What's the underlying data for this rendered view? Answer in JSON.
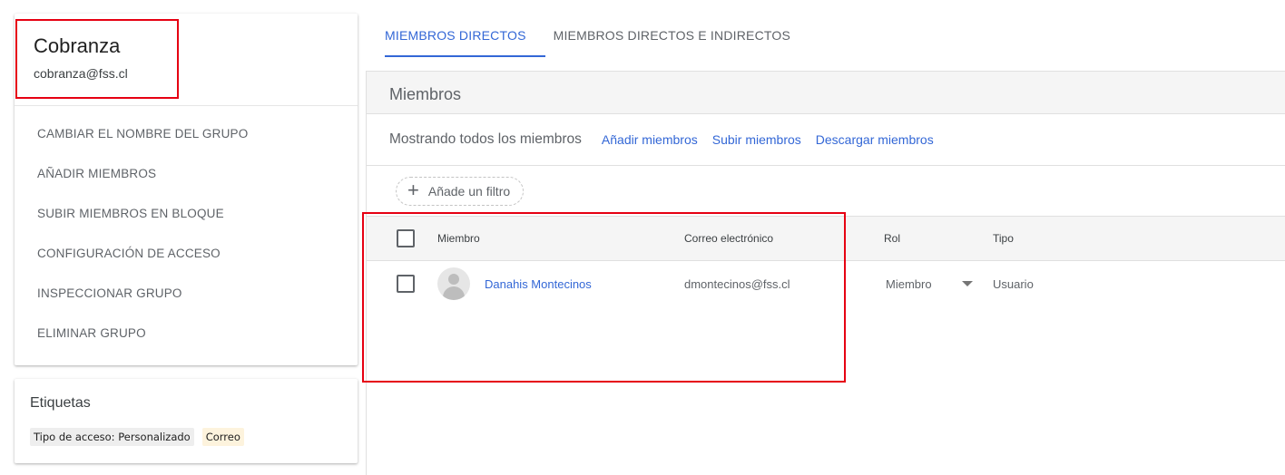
{
  "group": {
    "name": "Cobranza",
    "email": "cobranza@fss.cl",
    "actions": [
      {
        "label": "CAMBIAR EL NOMBRE DEL GRUPO"
      },
      {
        "label": "AÑADIR MIEMBROS"
      },
      {
        "label": "SUBIR MIEMBROS EN BLOQUE"
      },
      {
        "label": "CONFIGURACIÓN DE ACCESO"
      },
      {
        "label": "INSPECCIONAR GRUPO"
      },
      {
        "label": "ELIMINAR GRUPO"
      }
    ]
  },
  "labels": {
    "title": "Etiquetas",
    "chips": [
      "Tipo de acceso: Personalizado",
      "Correo"
    ]
  },
  "tabs": [
    {
      "label": "MIEMBROS DIRECTOS",
      "active": true
    },
    {
      "label": "MIEMBROS DIRECTOS E INDIRECTOS",
      "active": false
    }
  ],
  "members": {
    "title": "Miembros",
    "summary": "Mostrando todos los miembros",
    "links": [
      "Añadir miembros",
      "Subir miembros",
      "Descargar miembros"
    ],
    "filter_label": "Añade un filtro",
    "columns": {
      "member": "Miembro",
      "email": "Correo electrónico",
      "role": "Rol",
      "type": "Tipo"
    },
    "rows": [
      {
        "name": "Danahis Montecinos",
        "email": "dmontecinos@fss.cl",
        "role": "Miembro",
        "type": "Usuario"
      }
    ]
  },
  "colors": {
    "accent": "#3367d6",
    "highlight": "#e60012"
  }
}
